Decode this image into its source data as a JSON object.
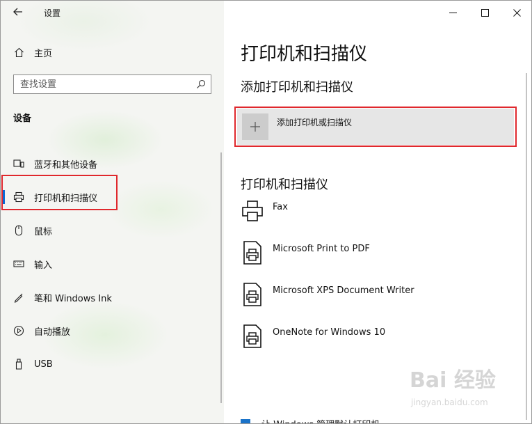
{
  "window": {
    "app_title": "设置",
    "controls": {
      "minimize": "—",
      "maximize": "☐",
      "close": "✕"
    }
  },
  "sidebar": {
    "home_label": "主页",
    "search_placeholder": "查找设置",
    "section_title": "设备",
    "items": [
      {
        "label": "蓝牙和其他设备",
        "icon": "bluetooth-device-icon",
        "selected": false
      },
      {
        "label": "打印机和扫描仪",
        "icon": "printer-icon",
        "selected": true
      },
      {
        "label": "鼠标",
        "icon": "mouse-icon",
        "selected": false
      },
      {
        "label": "输入",
        "icon": "keyboard-icon",
        "selected": false
      },
      {
        "label": "笔和 Windows Ink",
        "icon": "pen-icon",
        "selected": false
      },
      {
        "label": "自动播放",
        "icon": "autoplay-icon",
        "selected": false
      },
      {
        "label": "USB",
        "icon": "usb-icon",
        "selected": false
      }
    ]
  },
  "main": {
    "page_title": "打印机和扫描仪",
    "add_section_title": "添加打印机和扫描仪",
    "add_button_label": "添加打印机或扫描仪",
    "list_title": "打印机和扫描仪",
    "printers": [
      {
        "name": "Fax",
        "icon": "fax-printer-icon"
      },
      {
        "name": "Microsoft Print to PDF",
        "icon": "document-printer-icon"
      },
      {
        "name": "Microsoft XPS Document Writer",
        "icon": "document-printer-icon"
      },
      {
        "name": "OneNote for Windows 10",
        "icon": "document-printer-icon"
      }
    ],
    "partial_item_text": "让 Windows 管理默认打印机"
  },
  "watermark": {
    "brand": "Bai 经验",
    "site": "jingyan.baidu.com"
  },
  "colors": {
    "accent": "#0a6cd6",
    "highlight_border": "#e0282d",
    "add_button_bg": "#e6e6e6"
  }
}
